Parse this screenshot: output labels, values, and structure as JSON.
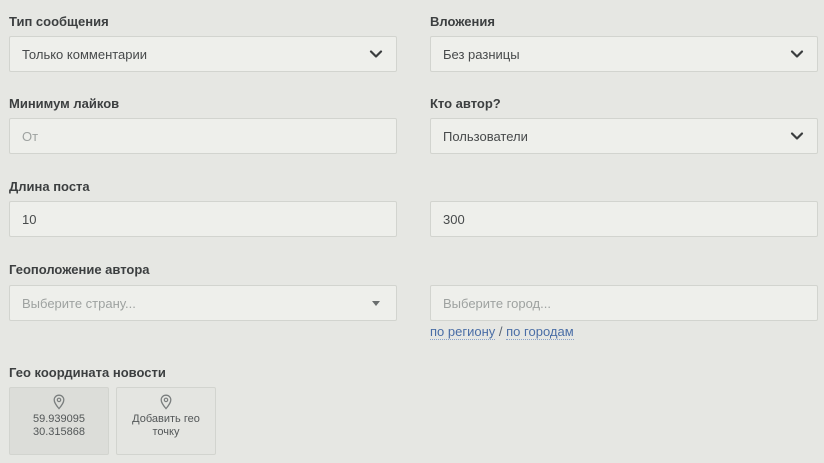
{
  "filters": {
    "message_type": {
      "label": "Тип сообщения",
      "value": "Только комментарии"
    },
    "attachments": {
      "label": "Вложения",
      "value": "Без разницы"
    },
    "min_likes": {
      "label": "Минимум лайков",
      "placeholder": "От"
    },
    "author_type": {
      "label": "Кто автор?",
      "value": "Пользователи"
    },
    "post_length": {
      "label": "Длина поста",
      "min_value": "10",
      "max_value": "300"
    },
    "author_geo": {
      "label": "Геоположение автора",
      "country_placeholder": "Выберите страну...",
      "city_placeholder": "Выберите город...",
      "by_region_link": "по региону",
      "separator": "/",
      "by_cities_link": "по городам"
    },
    "news_geo": {
      "label": "Гео координата новости",
      "point": {
        "lat": "59.939095",
        "lon": "30.315868"
      },
      "add_point_line1": "Добавить гео",
      "add_point_line2": "точку"
    }
  },
  "icons": {
    "select": "chevron-down-icon",
    "country_select": "caret-down-icon",
    "geo": "map-pin-icon"
  },
  "colors": {
    "background": "#e6e7e3",
    "field": "#eeefeb",
    "link": "#4a6ea6"
  }
}
